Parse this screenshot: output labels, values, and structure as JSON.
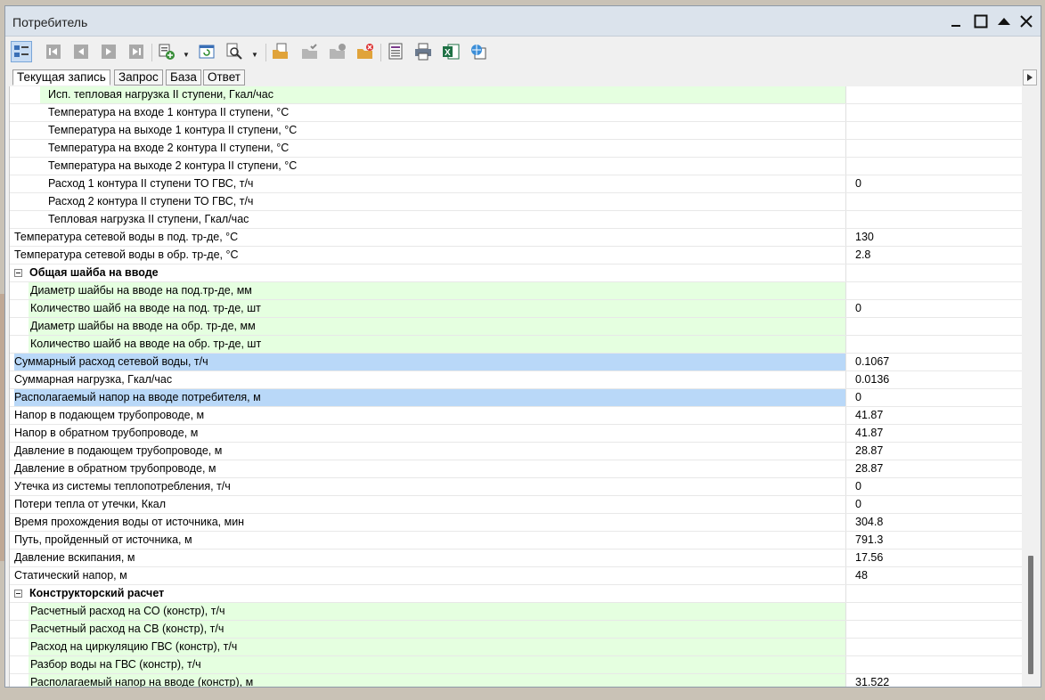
{
  "window": {
    "title": "Потребитель"
  },
  "tabs": [
    {
      "label": "Текущая запись",
      "active": true
    },
    {
      "label": "Запрос",
      "active": false
    },
    {
      "label": "База",
      "active": false
    },
    {
      "label": "Ответ",
      "active": false
    }
  ],
  "rows": [
    {
      "name": "Исп. тепловая нагрузка II ступени, Гкал/час",
      "value": "",
      "level": 3,
      "style": "green"
    },
    {
      "name": "Температура на входе 1 контура II ступени, °С",
      "value": "",
      "level": 3,
      "style": ""
    },
    {
      "name": "Температура на выходе 1 контура II ступени, °С",
      "value": "",
      "level": 3,
      "style": ""
    },
    {
      "name": "Температура на входе 2 контура II ступени, °С",
      "value": "",
      "level": 3,
      "style": ""
    },
    {
      "name": "Температура на выходе 2 контура II ступени, °С",
      "value": "",
      "level": 3,
      "style": ""
    },
    {
      "name": "Расход 1 контура II ступени ТО ГВС, т/ч",
      "value": "0",
      "level": 3,
      "style": ""
    },
    {
      "name": "Расход 2 контура II ступени ТО ГВС, т/ч",
      "value": "",
      "level": 3,
      "style": ""
    },
    {
      "name": "Тепловая нагрузка II ступени, Гкал/час",
      "value": "",
      "level": 3,
      "style": ""
    },
    {
      "name": "Температура сетевой воды в под. тр-де, °С",
      "value": "130",
      "level": 1,
      "style": ""
    },
    {
      "name": "Температура сетевой воды в обр. тр-де, °С",
      "value": "2.8",
      "level": 1,
      "style": ""
    },
    {
      "name": "Общая шайба на вводе",
      "value": "",
      "level": 0,
      "style": "group"
    },
    {
      "name": "Диаметр шайбы на вводе на под.тр-де, мм",
      "value": "",
      "level": 2,
      "style": "green"
    },
    {
      "name": "Количество шайб на вводе на под. тр-де, шт",
      "value": "0",
      "level": 2,
      "style": "green"
    },
    {
      "name": "Диаметр шайбы на вводе на обр. тр-де, мм",
      "value": "",
      "level": 2,
      "style": "green"
    },
    {
      "name": "Количество шайб на вводе на обр. тр-де, шт",
      "value": "",
      "level": 2,
      "style": "green"
    },
    {
      "name": "Суммарный расход сетевой воды, т/ч",
      "value": "0.1067",
      "level": 1,
      "style": "sel"
    },
    {
      "name": "Суммарная нагрузка, Гкал/час",
      "value": "0.0136",
      "level": 1,
      "style": ""
    },
    {
      "name": "Располагаемый напор на вводе потребителя, м",
      "value": "0",
      "level": 1,
      "style": "sel"
    },
    {
      "name": "Напор в подающем трубопроводе, м",
      "value": "41.87",
      "level": 1,
      "style": ""
    },
    {
      "name": "Напор в обратном трубопроводе, м",
      "value": "41.87",
      "level": 1,
      "style": ""
    },
    {
      "name": "Давление в подающем трубопроводе, м",
      "value": "28.87",
      "level": 1,
      "style": ""
    },
    {
      "name": "Давление в обратном трубопроводе, м",
      "value": "28.87",
      "level": 1,
      "style": ""
    },
    {
      "name": "Утечка из системы теплопотребления, т/ч",
      "value": "0",
      "level": 1,
      "style": ""
    },
    {
      "name": "Потери тепла от утечки, Ккал",
      "value": "0",
      "level": 1,
      "style": ""
    },
    {
      "name": "Время прохождения воды от источника, мин",
      "value": "304.8",
      "level": 1,
      "style": ""
    },
    {
      "name": "Путь, пройденный от источника, м",
      "value": "791.3",
      "level": 1,
      "style": ""
    },
    {
      "name": "Давление вскипания, м",
      "value": "17.56",
      "level": 1,
      "style": ""
    },
    {
      "name": "Статический напор, м",
      "value": "48",
      "level": 1,
      "style": ""
    },
    {
      "name": "Конструкторский расчет",
      "value": "",
      "level": 0,
      "style": "group"
    },
    {
      "name": "Расчетный расход на СО (констр), т/ч",
      "value": "",
      "level": 2,
      "style": "green"
    },
    {
      "name": "Расчетный расход на СВ (констр), т/ч",
      "value": "",
      "level": 2,
      "style": "green"
    },
    {
      "name": "Расход на циркуляцию ГВС (констр), т/ч",
      "value": "",
      "level": 2,
      "style": "green"
    },
    {
      "name": "Разбор воды на ГВС (констр), т/ч",
      "value": "",
      "level": 2,
      "style": "green"
    },
    {
      "name": "Располагаемый напор на вводе (констр), м",
      "value": "31.522",
      "level": 2,
      "style": "green"
    }
  ],
  "colors": {
    "green_row": "#e5ffe0",
    "selected_row": "#b9d8f8"
  }
}
